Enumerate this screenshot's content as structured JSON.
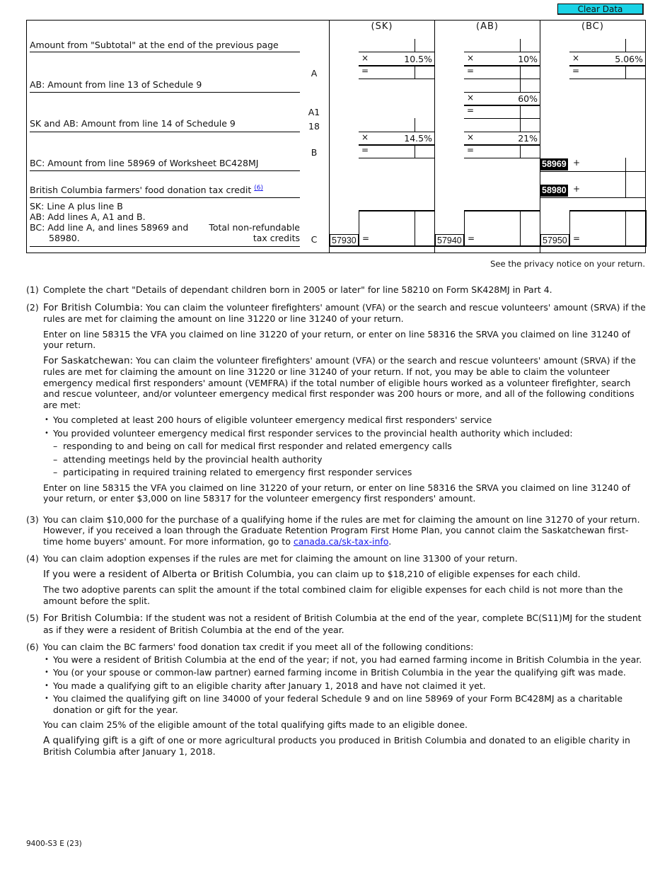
{
  "toolbar": {
    "clear_label": "Clear Data",
    "clear_color": "#1ad3e6"
  },
  "columns": [
    {
      "id": "sk",
      "label": "(SK)"
    },
    {
      "id": "ab",
      "label": "(AB)"
    },
    {
      "id": "bc",
      "label": "(BC)"
    }
  ],
  "rows": {
    "subtotal": {
      "label": "Amount from \"Subtotal\" at the end of the previous page",
      "letter": "A"
    },
    "ab_line13": {
      "label": "AB: Amount from line 13 of Schedule 9",
      "letter": "A1"
    },
    "line14": {
      "label": "SK and AB: Amount from line 14 of Schedule 9",
      "letter": "18"
    },
    "bc_58969": {
      "label": "BC: Amount from line 58969 of Worksheet BC428MJ",
      "letter": "B"
    },
    "bc_farmers": {
      "label": "British Columbia farmers' food donation tax credit",
      "footnote": "(6)"
    },
    "total": {
      "desc_lines": [
        "SK: Line A plus line B",
        "AB: Add lines A, A1 and B.",
        "BC: Add line A, and lines 58969 and",
        "58980."
      ],
      "label_line1": "Total non-refundable",
      "label_line2": "tax credits",
      "letter": "C"
    }
  },
  "rates": {
    "sk_a": "10.5%",
    "ab_a": "10%",
    "bc_a": "5.06%",
    "ab_a1": "60%",
    "sk_b": "14.5%",
    "ab_b": "21%"
  },
  "operators": {
    "times": "×",
    "equals": "=",
    "plus": "+"
  },
  "line_codes": {
    "bc_58969": "58969",
    "bc_58980": "58980",
    "sk_total": "57930",
    "ab_total": "57940",
    "bc_total": "57950"
  },
  "privacy_notice": "See the privacy notice on your return.",
  "notes": {
    "n1": {
      "num": "(1)",
      "text": "Complete the chart \"Details of dependant children born in 2005 or later\" for line 58210 on Form SK428MJ in Part 4."
    },
    "n2": {
      "num": "(2)",
      "bc_lead": "For British Columbia:",
      "bc_text": " You can claim the volunteer firefighters' amount (VFA) or the search and rescue volunteers' amount (SRVA) if the rules are met for claiming the amount on line 31220 or line 31240 of your return.",
      "bc_enter": "Enter on line 58315 the VFA you claimed on line 31220 of your return, or enter on line 58316 the SRVA you claimed on line 31240 of your return.",
      "sk_lead": "For Saskatchewan:",
      "sk_text": " You can claim the volunteer firefighters' amount (VFA) or the search and rescue volunteers' amount (SRVA) if the rules are met for claiming the amount on line 31220 or line 31240 of your return. If not, you may be able to claim the volunteer emergency medical first responders' amount (VEMFRA) if the total number of eligible hours worked as a volunteer firefighter, search and rescue volunteer, and/or volunteer emergency medical first responder was 200 hours or more, and all of the following conditions are met:",
      "bullets": [
        "You completed at least 200 hours of eligible volunteer emergency medical first responders' service",
        "You provided volunteer emergency medical first responder services to the provincial health authority which included:"
      ],
      "dashes": [
        "responding to and being on call for medical first responder and related emergency calls",
        "attending meetings held by the provincial health authority",
        "participating in required training related to emergency first responder services"
      ],
      "sk_enter": "Enter on line 58315 the VFA you claimed on line 31220 of your return, or enter on line 58316 the SRVA you claimed on line 31240 of your return, or enter $3,000 on line 58317 for the volunteer emergency first responders' amount."
    },
    "n3": {
      "num": "(3)",
      "text": "You can claim $10,000 for the purchase of a qualifying home if the rules are met for claiming the amount on line 31270 of your return. However, if you received a loan through the Graduate Retention Program First Home Plan, you cannot claim the Saskatchewan first-time home buyers' amount. For more information, go to ",
      "link": "canada.ca/sk-tax-info",
      "after": "."
    },
    "n4": {
      "num": "(4)",
      "text": "You can claim adoption expenses if the rules are met for claiming the amount on line 31300 of your return.",
      "lead": "If you were a resident of Alberta or British Columbia,",
      "lead_after": " you can claim up to $18,210 of eligible expenses for each child.",
      "split": "The two adoptive parents can split the amount if the total combined claim for eligible expenses for each child is not more than the amount before the split."
    },
    "n5": {
      "num": "(5)",
      "lead": "For British Columbia:",
      "text": " If the student was not a resident of British Columbia at the end of the year, complete BC(S11)MJ for the student as if they were a resident of British Columbia at the end of the year."
    },
    "n6": {
      "num": "(6)",
      "text": "You can claim the BC farmers' food donation tax credit if you meet all of the following conditions:",
      "bullets": [
        "You were a resident of British Columbia at the end of the year; if not, you had earned farming income in British Columbia in the year.",
        "You (or your spouse or common-law partner) earned farming income in British Columbia in the year the qualifying gift was made.",
        "You made a qualifying gift to an eligible charity after January 1, 2018 and have not claimed it yet.",
        "You claimed the qualifying gift on line 34000 of your federal Schedule 9 and on line 58969 of your Form BC428MJ as a charitable donation or gift for the year."
      ],
      "percent": "You can claim 25% of the eligible amount of the total qualifying gifts made to an eligible donee.",
      "lead": "A qualifying gift",
      "lead_after": " is a gift of one or more agricultural products you produced in British Columbia and donated to an eligible charity in British Columbia after January 1, 2018."
    }
  },
  "form_number": "9400-S3 E (23)"
}
